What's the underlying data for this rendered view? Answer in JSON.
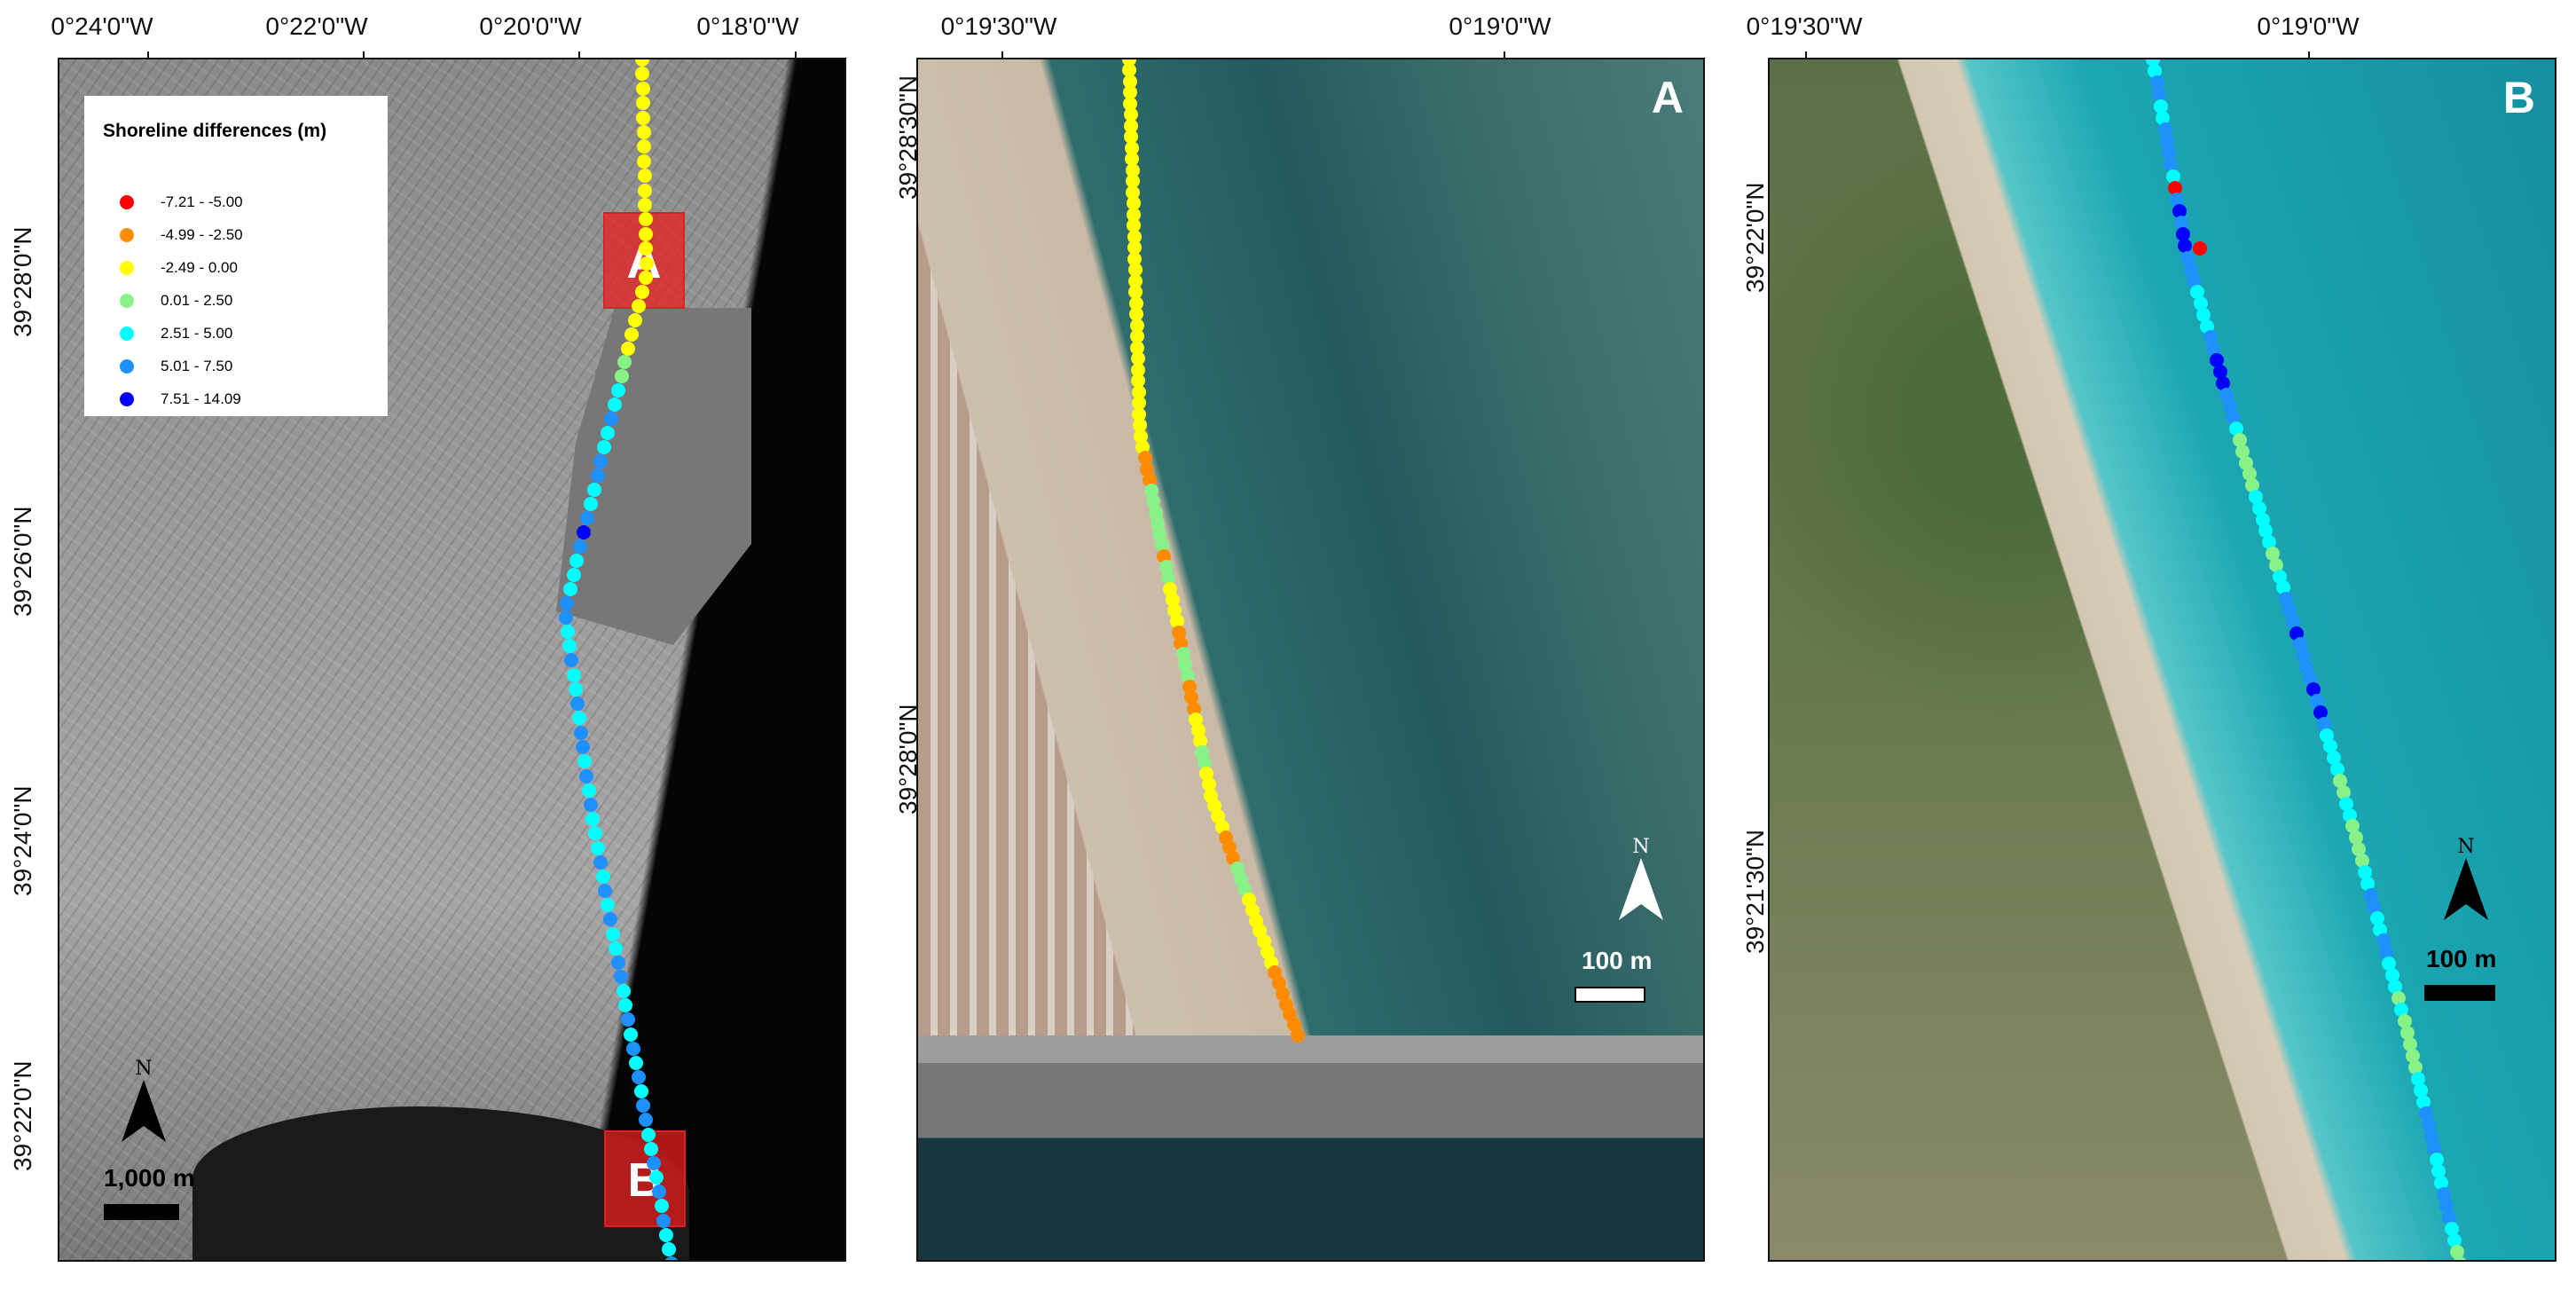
{
  "legend": {
    "title": "Shoreline differences (m)",
    "classes": [
      {
        "label": "-7.21 - -5.00",
        "color": "#ff0000"
      },
      {
        "label": "-4.99 - -2.50",
        "color": "#ff8c00"
      },
      {
        "label": "-2.49 - 0.00",
        "color": "#ffff00"
      },
      {
        "label": "0.01 - 2.50",
        "color": "#88f288"
      },
      {
        "label": "2.51 - 5.00",
        "color": "#00ffff"
      },
      {
        "label": "5.01 - 7.50",
        "color": "#1e90ff"
      },
      {
        "label": "7.51 - 14.09",
        "color": "#0000ff"
      }
    ]
  },
  "overview": {
    "lon_labels": [
      "0°24'0\"W",
      "0°22'0\"W",
      "0°20'0\"W",
      "0°18'0\"W"
    ],
    "lat_labels": [
      "39°28'0\"N",
      "39°26'0\"N",
      "39°24'0\"N",
      "39°22'0\"N"
    ],
    "box_a": "A",
    "box_b": "B",
    "north": "N",
    "scale": "1,000 m",
    "sequence": "2222222222222222222223344544554456544455445445455454544454545445544545454554454545445"
  },
  "panel_a": {
    "label": "A",
    "lon_labels": [
      "0°19'30\"W",
      "0°19'0\"W"
    ],
    "lat_labels": [
      "39°28'30\"N",
      "39°28'0\"N"
    ],
    "north": "N",
    "scale": "100 m",
    "sequence": "2222222222222222222222222222222222221113333331332222113331112223322222211133322222221111111"
  },
  "panel_b": {
    "label": "B",
    "lon_labels": [
      "0°19'30\"W",
      "0°19'0\"W"
    ],
    "lat_labels": [
      "39°22'0\"N",
      "39°21'30\"N"
    ],
    "north": "N",
    "scale": "100 m",
    "sequence": "4455445555405656655544445566655543333344444334455565555656544443344333344554455444343333344455554445554433",
    "red_marker": "0"
  }
}
